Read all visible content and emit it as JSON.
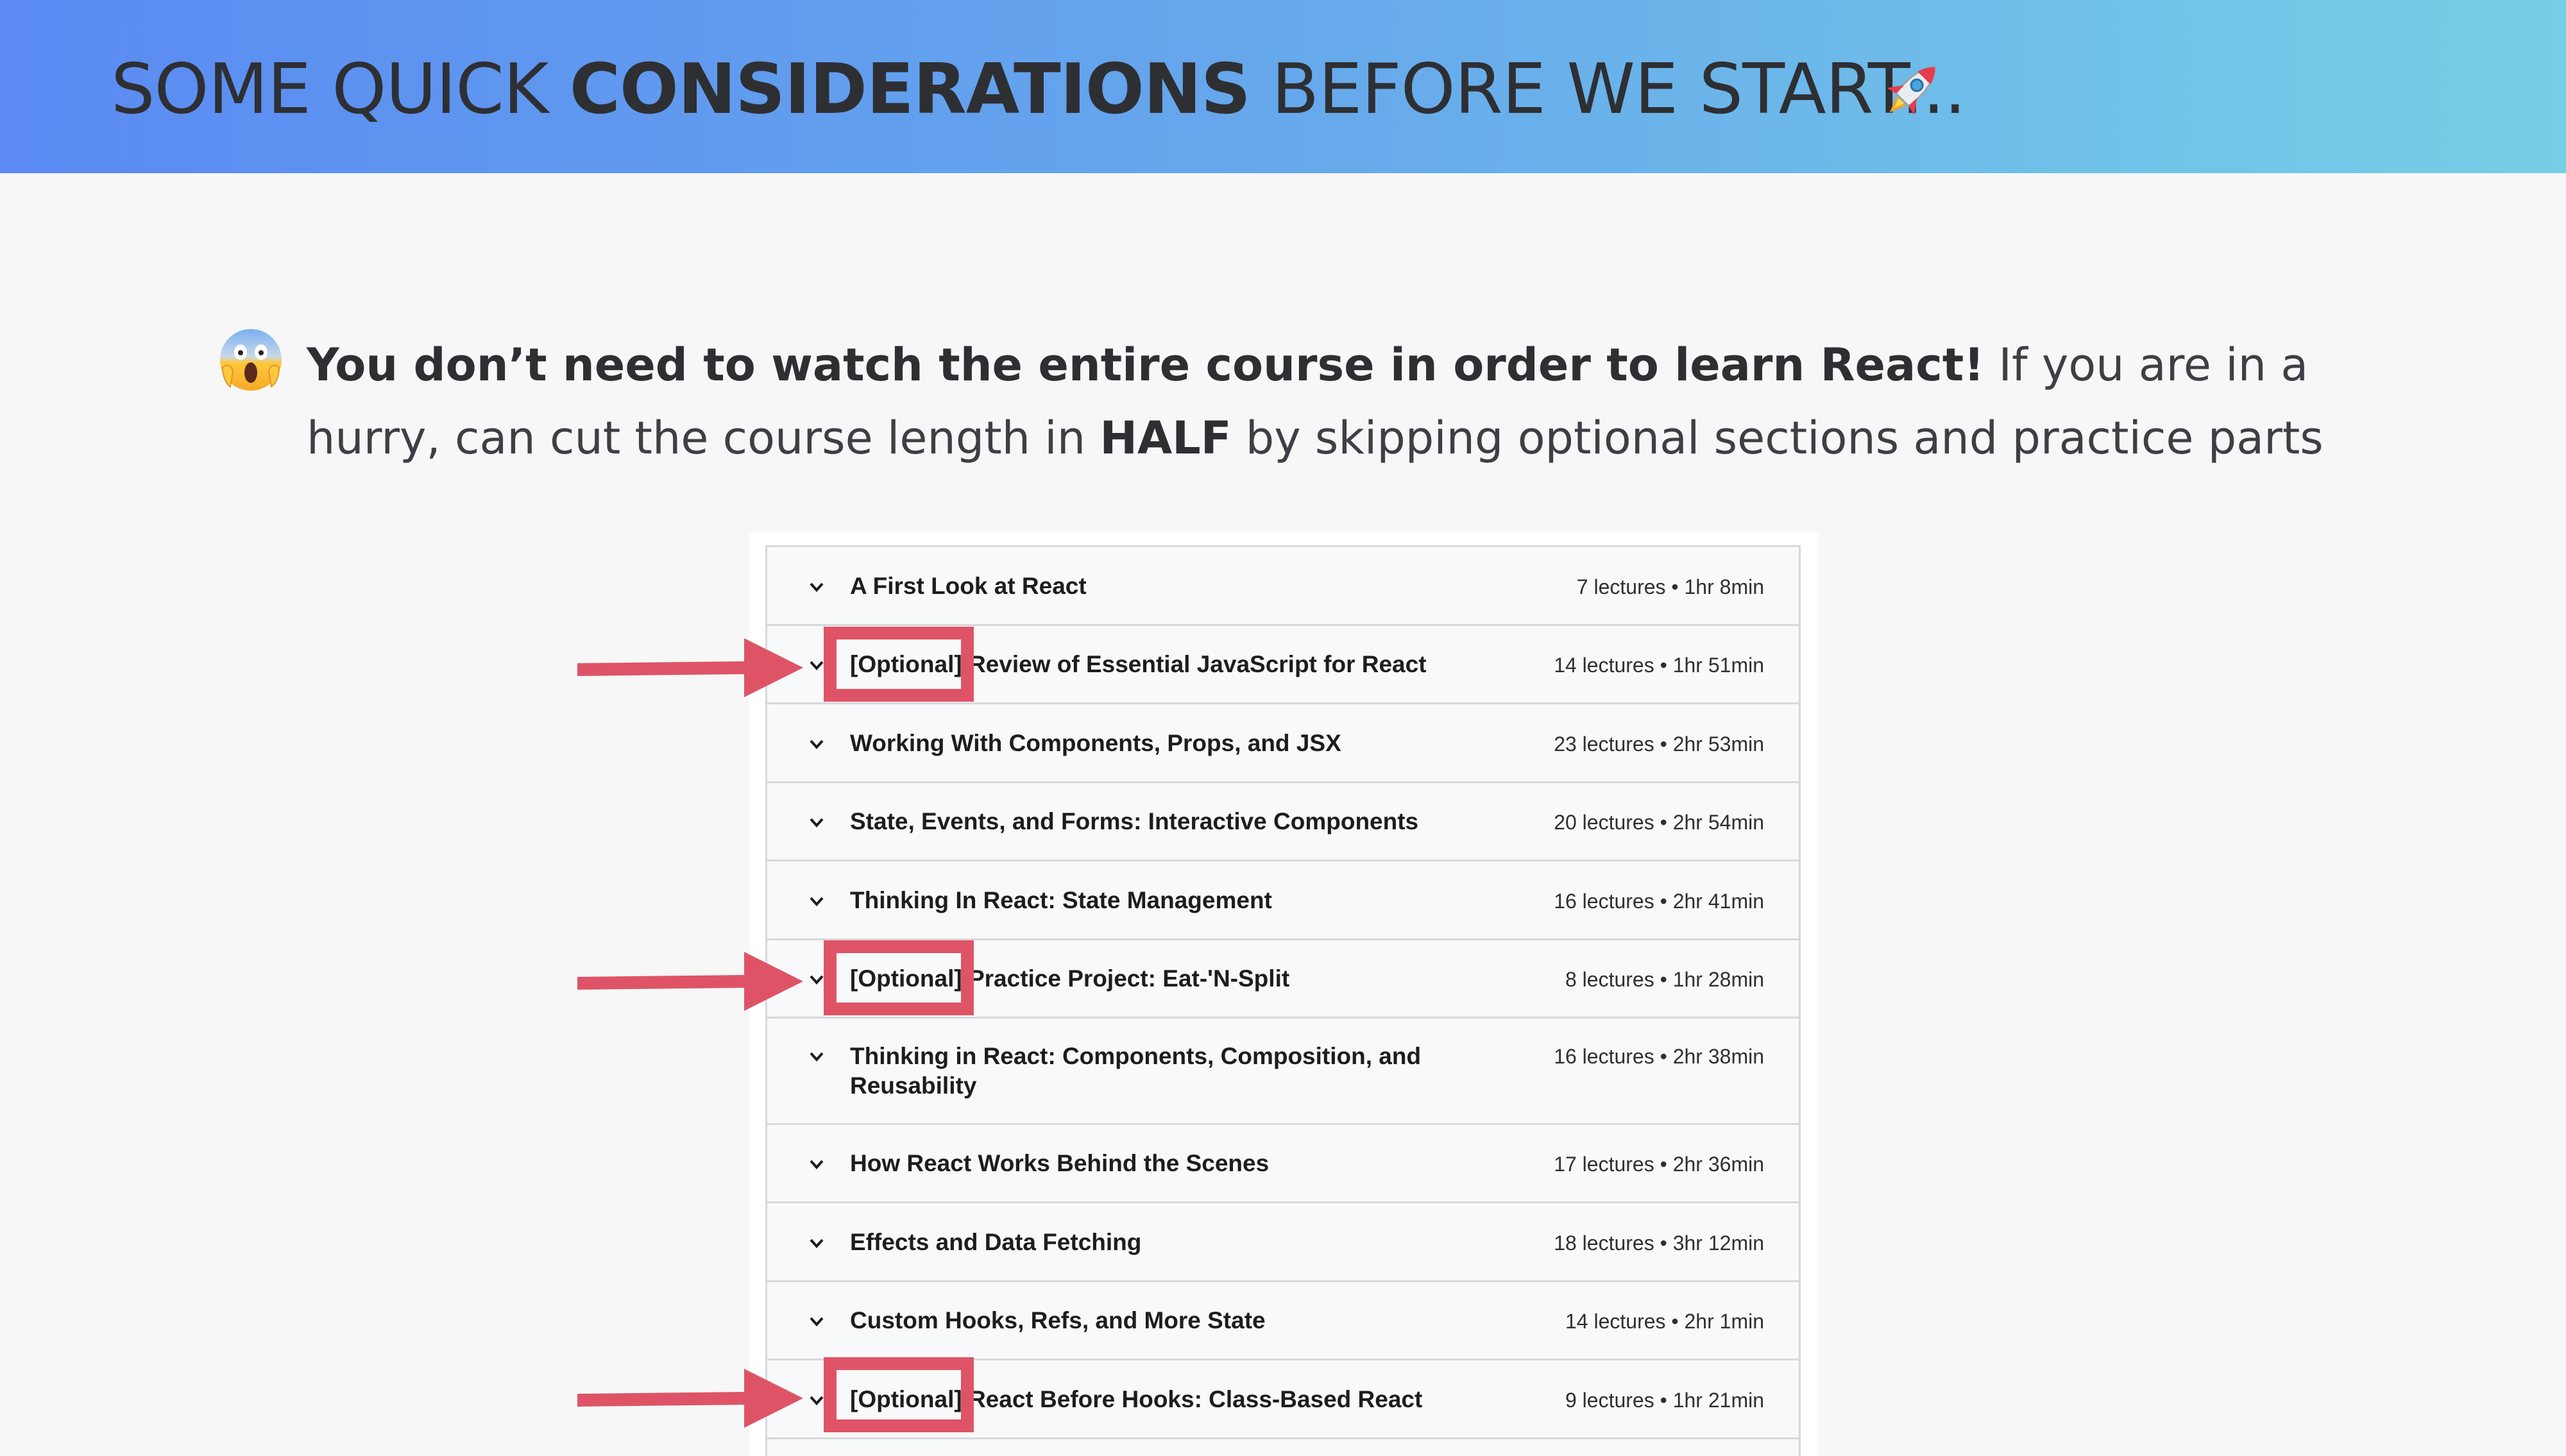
{
  "header": {
    "title_part1": "SOME QUICK ",
    "title_bold": "CONSIDERATIONS",
    "title_part2": " BEFORE WE START...",
    "rocket_icon": "rocket-emoji"
  },
  "intro": {
    "icon": "face-screaming-emoji",
    "bold_text": "You don’t need to watch the entire course in order to learn React!",
    "text_1": " If you are in a hurry, can cut the course length in ",
    "bold_half": "HALF",
    "text_2": " by skipping optional sections and practice parts"
  },
  "course_sections": [
    {
      "title": "A First Look at React",
      "meta": "7 lectures • 1hr 8min"
    },
    {
      "title": "[Optional] Review of Essential JavaScript for React",
      "meta": "14 lectures • 1hr 51min",
      "optional": true
    },
    {
      "title": "Working With Components, Props, and JSX",
      "meta": "23 lectures • 2hr 53min"
    },
    {
      "title": "State, Events, and Forms: Interactive Components",
      "meta": "20 lectures • 2hr 54min"
    },
    {
      "title": "Thinking In React: State Management",
      "meta": "16 lectures • 2hr 41min"
    },
    {
      "title": "[Optional] Practice Project: Eat-'N-Split",
      "meta": "8 lectures • 1hr 28min",
      "optional": true
    },
    {
      "title": "Thinking in React: Components, Composition, and Reusability",
      "meta": "16 lectures • 2hr 38min"
    },
    {
      "title": "How React Works Behind the Scenes",
      "meta": "17 lectures • 2hr 36min"
    },
    {
      "title": "Effects and Data Fetching",
      "meta": "18 lectures • 3hr 12min"
    },
    {
      "title": "Custom Hooks, Refs, and More State",
      "meta": "14 lectures • 2hr 1min"
    },
    {
      "title": "[Optional] React Before Hooks: Class-Based React",
      "meta": "9 lectures • 1hr 21min",
      "optional": true
    }
  ],
  "colors": {
    "header_gradient_start": "#5a8af2",
    "header_gradient_end": "#76cfe6",
    "annotation_red": "#de5466",
    "background": "#f7f7f8"
  }
}
